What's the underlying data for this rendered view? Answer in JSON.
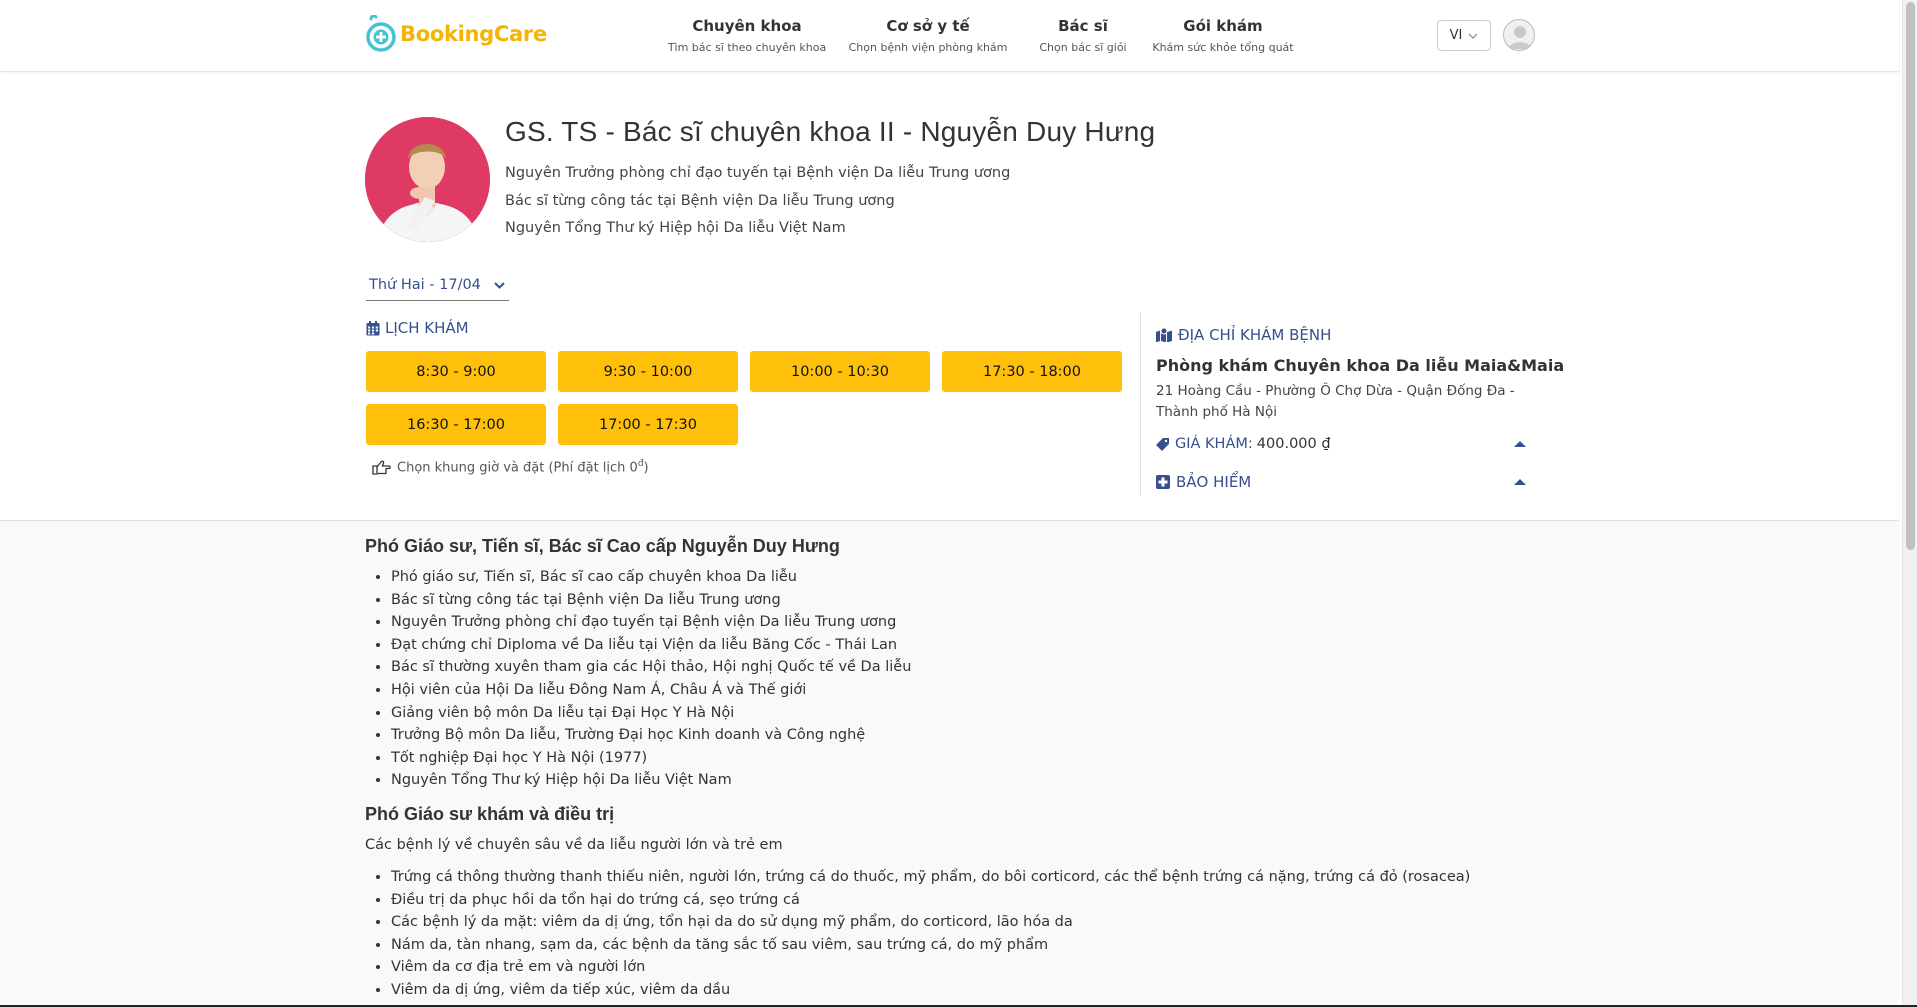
{
  "header": {
    "logo_text": "BookingCare",
    "nav": [
      {
        "title": "Chuyên khoa",
        "subtitle": "Tìm bác sĩ theo chuyên khoa"
      },
      {
        "title": "Cơ sở y tế",
        "subtitle": "Chọn bệnh viện phòng khám"
      },
      {
        "title": "Bác sĩ",
        "subtitle": "Chọn bác sĩ giỏi"
      },
      {
        "title": "Gói khám",
        "subtitle": "Khám sức khỏe tổng quát"
      }
    ],
    "language": "VI"
  },
  "doctor": {
    "name": "GS. TS - Bác sĩ chuyên khoa II - Nguyễn Duy Hưng",
    "description": [
      "Nguyên Trưởng phòng chỉ đạo tuyến tại Bệnh viện Da liễu Trung ương",
      "Bác sĩ từng công tác tại Bệnh viện Da liễu Trung ương",
      "Nguyên Tổng Thư ký Hiệp hội Da liễu Việt Nam"
    ]
  },
  "schedule": {
    "selected_date": "Thứ Hai - 17/04",
    "title": "LỊCH KHÁM",
    "slots": [
      "8:30 - 9:00",
      "9:30 - 10:00",
      "10:00 - 10:30",
      "17:30 - 18:00",
      "16:30 - 17:00",
      "17:00 - 17:30"
    ],
    "note_prefix": "Chọn khung giờ và đặt (Phí đặt lịch 0",
    "note_sup": "đ",
    "note_suffix": ")"
  },
  "clinic": {
    "address_title": "ĐỊA CHỈ KHÁM BỆNH",
    "name": "Phòng khám Chuyên khoa Da liễu Maia&Maia",
    "address": "21 Hoàng Cầu - Phường Ô Chợ Dừa - Quận Đống Đa - Thành phố Hà Nội",
    "price_label": "GIÁ KHÁM:",
    "price_value": "400.000 ₫",
    "insurance_label": "BẢO HIỂM"
  },
  "detail": {
    "heading1": "Phó Giáo sư, Tiến sĩ, Bác sĩ Cao cấp Nguyễn Duy Hưng",
    "list1": [
      "Phó giáo sư, Tiến sĩ, Bác sĩ cao cấp chuyên khoa Da liễu",
      "Bác sĩ từng công tác tại Bệnh viện Da liễu Trung ương",
      "Nguyên Trưởng phòng chỉ đạo tuyến tại Bệnh viện Da liễu Trung ương",
      "Đạt chứng chỉ Diploma về Da liễu tại Viện da liễu Băng Cốc - Thái Lan",
      "Bác sĩ thường xuyên tham gia các Hội thảo, Hội nghị Quốc tế về Da liễu",
      "Hội viên của Hội Da liễu Đông Nam Á, Châu Á và Thế giới",
      "Giảng viên bộ môn Da liễu tại Đại Học Y Hà Nội",
      "Trưởng Bộ môn Da liễu, Trường Đại học Kinh doanh và Công nghệ",
      "Tốt nghiệp Đại học Y Hà Nội (1977)",
      "Nguyên Tổng Thư ký Hiệp hội Da liễu Việt Nam"
    ],
    "heading2": "Phó Giáo sư khám và điều trị",
    "paragraph": "Các bệnh lý về chuyên sâu về da liễu người lớn và trẻ em",
    "list2": [
      "Trứng cá thông thường thanh thiếu niên, người lớn, trứng cá do thuốc, mỹ phẩm, do bôi corticord, các thể bệnh trứng cá nặng, trứng cá đỏ (rosacea)",
      "Điều trị da phục hồi da tổn hại do trứng cá, sẹo trứng cá",
      "Các bệnh lý da mặt: viêm da dị ứng, tổn hại da do sử dụng mỹ phẩm, do corticord, lão hóa da",
      "Nám da, tàn nhang, sạm da, các bệnh da tăng sắc tố sau viêm, sau trứng cá, do mỹ phẩm",
      "Viêm da cơ địa trẻ em và người lớn",
      "Viêm da dị ứng, viêm da tiếp xúc, viêm da dầu"
    ]
  },
  "colors": {
    "brand": "#f4b400",
    "link_blue": "#35508d",
    "slot_yellow": "#ffc00b",
    "logo_blue": "#45c3d2"
  }
}
